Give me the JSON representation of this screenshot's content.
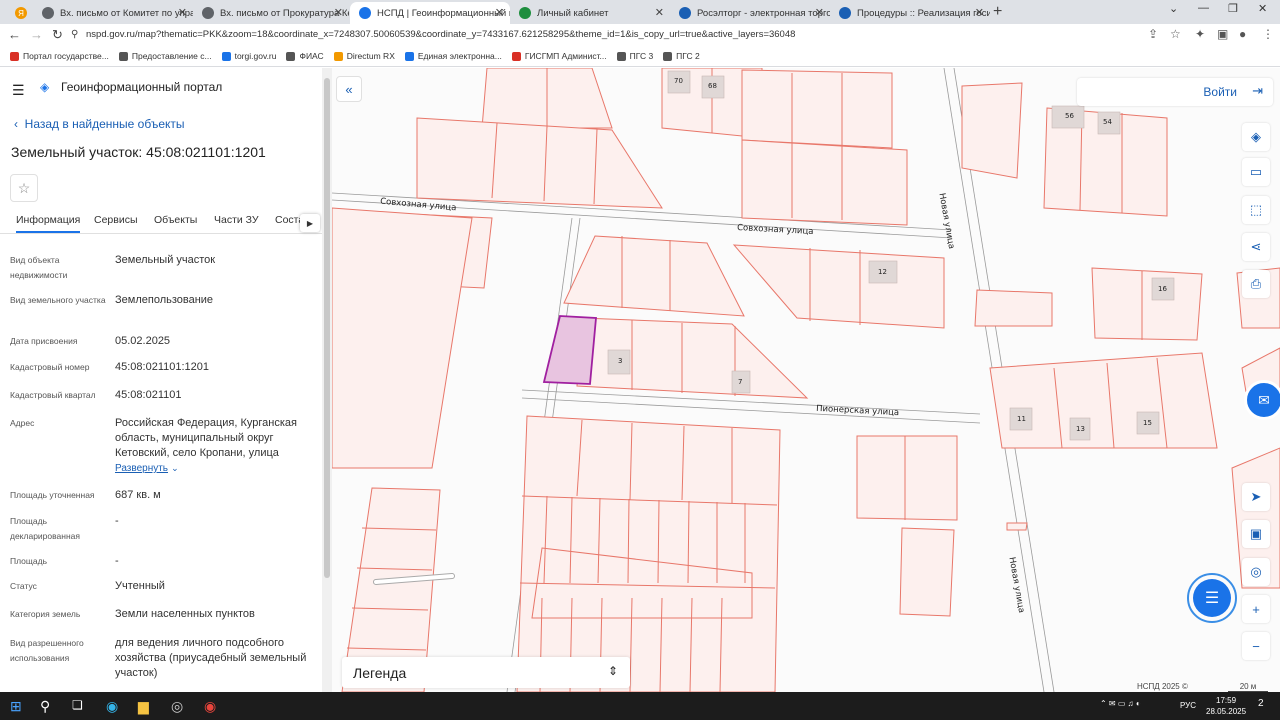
{
  "browser": {
    "tabs": [
      {
        "title": "",
        "color": "#f29900"
      },
      {
        "title": "Вх. письмо от Комитет по упра",
        "color": "#5f6368"
      },
      {
        "title": "Вх. письмо от Прокуратура Кет",
        "color": "#5f6368"
      },
      {
        "title": "НСПД | Геоинформационный п",
        "color": "#1a73e8"
      },
      {
        "title": "Личный кабинет",
        "color": "#1e8e3e"
      },
      {
        "title": "Росэлторг - электронная торгов",
        "color": "#1a5fb4"
      },
      {
        "title": "Процедуры :: Реализация госи",
        "color": "#1a5fb4"
      }
    ],
    "url": "nspd.gov.ru/map?thematic=PKK&zoom=18&coordinate_x=7248307.50060539&coordinate_y=7433167.621258295&theme_id=1&is_copy_url=true&active_layers=36048",
    "bookmarks": [
      {
        "label": "Портал государстве...",
        "color": "#d93025"
      },
      {
        "label": "Предоставление с...",
        "color": "#555"
      },
      {
        "label": "torgi.gov.ru",
        "color": "#1a73e8"
      },
      {
        "label": "ФИАС",
        "color": "#555"
      },
      {
        "label": "Directum RX",
        "color": "#f29900"
      },
      {
        "label": "Единая электронна...",
        "color": "#1a73e8"
      },
      {
        "label": "ГИСГМП Админист...",
        "color": "#d93025"
      },
      {
        "label": "ПГС 3",
        "color": "#555"
      },
      {
        "label": "ПГС 2",
        "color": "#555"
      }
    ]
  },
  "panel": {
    "portal_title": "Геоинформационный портал",
    "back_link": "Назад в найденные объекты",
    "heading": "Земельный участок: 45:08:021101:1201",
    "tabs": [
      "Информация",
      "Сервисы",
      "Объекты",
      "Части ЗУ",
      "Соста"
    ],
    "fields": [
      {
        "label": "Вид объекта недвижимости",
        "value": "Земельный участок"
      },
      {
        "label": "Вид земельного участка",
        "value": "Землепользование"
      },
      {
        "label": "Дата присвоения",
        "value": "05.02.2025"
      },
      {
        "label": "Кадастровый номер",
        "value": "45:08:021101:1201"
      },
      {
        "label": "Кадастровый квартал",
        "value": "45:08:021101"
      },
      {
        "label": "Адрес",
        "value": "Российская Федерация, Курганская область, муниципальный округ Кетовский, село Кропани, улица"
      },
      {
        "label": "Площадь уточненная",
        "value": "687 кв. м"
      },
      {
        "label": "Площадь декларированная",
        "value": "-"
      },
      {
        "label": "Площадь",
        "value": "-"
      },
      {
        "label": "Статус",
        "value": "Учтенный"
      },
      {
        "label": "Категория земель",
        "value": "Земли населенных пунктов"
      },
      {
        "label": "Вид разрешенного использования",
        "value": "для ведения личного подсобного хозяйства (приусадебный земельный участок)"
      }
    ],
    "expand_label": "Развернуть"
  },
  "map": {
    "login_label": "Войти",
    "legend_label": "Легенда",
    "copyright": "НСПД 2025 ©",
    "scale": "20 м",
    "streets": [
      "Совхозная улица",
      "Совхозная улица",
      "Новая улица",
      "Пионерская улица",
      "Новая улица"
    ],
    "parcel_numbers": [
      "70",
      "68",
      "56",
      "54",
      "12",
      "16",
      "3",
      "7",
      "11",
      "13",
      "15"
    ],
    "colors": {
      "parcel_stroke": "#e8776a",
      "parcel_fill": "#fdf0ee",
      "selected_fill": "#e8c4e0",
      "selected_stroke": "#a020a0"
    }
  },
  "taskbar": {
    "lang": "РУС",
    "time": "17:59",
    "date": "28.05.2025",
    "notifications": "2"
  }
}
